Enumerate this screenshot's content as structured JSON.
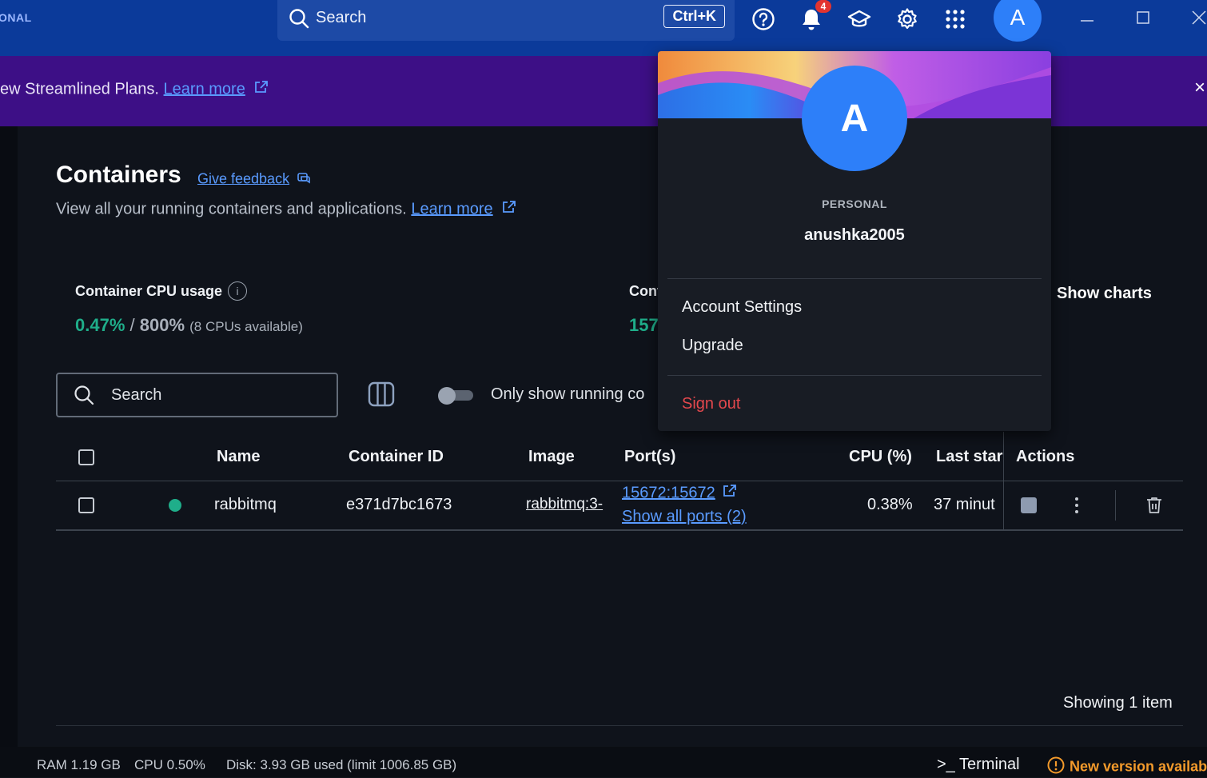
{
  "titlebar": {
    "brand": "ONAL",
    "search_label": "Search",
    "search_shortcut": "Ctrl+K",
    "notification_count": "4",
    "avatar_letter": "A",
    "icons": [
      "help-icon",
      "bell-icon",
      "learning-center-icon",
      "gear-icon",
      "apps-grid-icon"
    ],
    "window_buttons": [
      "minimize",
      "maximize",
      "close"
    ]
  },
  "banner": {
    "text": "ew Streamlined Plans. ",
    "link": "Learn more",
    "close": "×"
  },
  "page": {
    "title": "Containers",
    "feedback_link": "Give feedback",
    "subtitle": "View all your running containers and applications. ",
    "subtitle_link": "Learn more"
  },
  "stats": {
    "cpu_label": "Container CPU usage",
    "cpu_used": "0.47%",
    "cpu_sep": " / ",
    "cpu_total": "800%",
    "cpu_note": "(8 CPUs available)",
    "mem_label": "Cont",
    "mem_value": "157",
    "show_charts": "Show charts"
  },
  "toolbar": {
    "search_placeholder": "Search",
    "toggle_label": "Only show running co",
    "toggle_on": false
  },
  "table": {
    "columns": [
      "Name",
      "Container ID",
      "Image",
      "Port(s)",
      "CPU (%)",
      "Last star",
      "Actions"
    ],
    "rows": [
      {
        "name": "rabbitmq",
        "id": "e371d7bc1673",
        "image": "rabbitmq:3-",
        "port": "15672:15672",
        "ports_link": "Show all ports (2)",
        "cpu": "0.38%",
        "last_started": "37 minut",
        "status": "running"
      }
    ],
    "footer": "Showing 1 item"
  },
  "statusbar": {
    "ram": "RAM 1.19 GB",
    "cpu": "CPU 0.50%",
    "disk": "Disk: 3.93 GB used (limit 1006.85 GB)",
    "terminal": ">_ Terminal",
    "update": "New version availabl"
  },
  "account_menu": {
    "avatar_letter": "A",
    "plan": "PERSONAL",
    "username": "anushka2005",
    "items": [
      "Account Settings",
      "Upgrade"
    ],
    "sign_out": "Sign out"
  },
  "colors": {
    "titlebar": "#0b3a9a",
    "banner": "#3d0f86",
    "accent": "#2d7ff9",
    "running": "#1fae8a",
    "danger": "#e5484d",
    "warning": "#f39a2b"
  }
}
